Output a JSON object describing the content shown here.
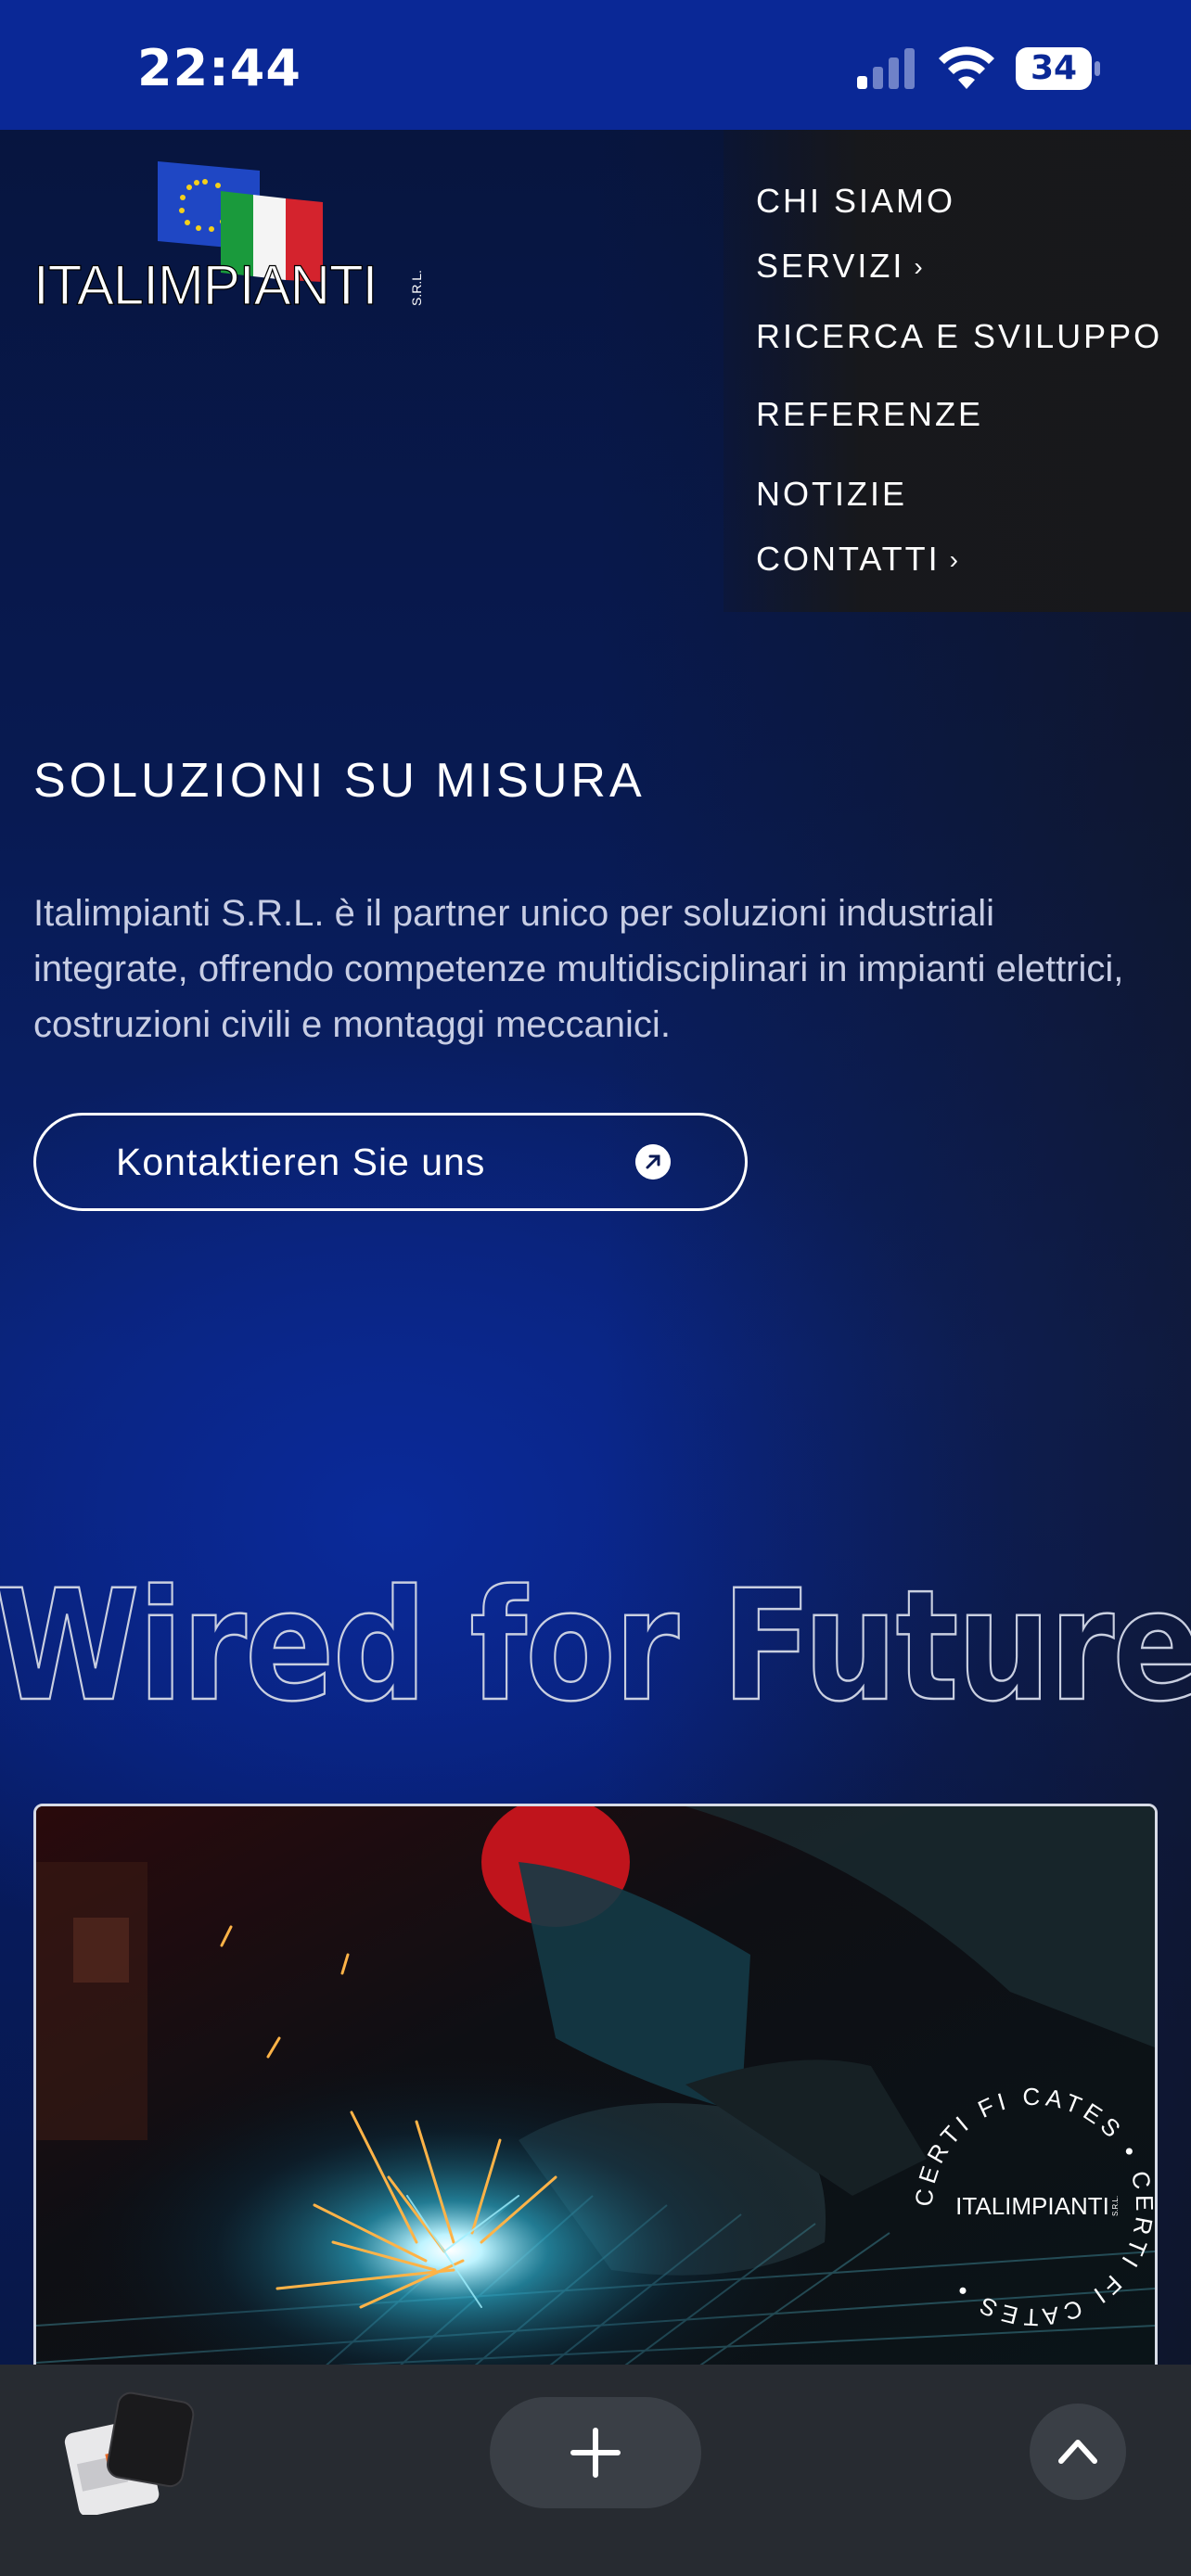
{
  "status": {
    "time": "22:44",
    "battery": "34",
    "signal_icon": "cellular-signal-icon",
    "wifi_icon": "wifi-icon",
    "battery_icon": "battery-icon"
  },
  "logo": {
    "brand": "ITALIMPIANTI",
    "suffix": "S.R.L."
  },
  "nav": {
    "items": [
      {
        "label": "CHI SIAMO",
        "has_submenu": false
      },
      {
        "label": "SERVIZI",
        "has_submenu": true
      },
      {
        "label": "RICERCA E SVILUPPO",
        "has_submenu": false
      },
      {
        "label": "REFERENZE",
        "has_submenu": false
      },
      {
        "label": "NOTIZIE",
        "has_submenu": false
      },
      {
        "label": "CONTATTI",
        "has_submenu": true
      }
    ],
    "chevron": "›"
  },
  "hero": {
    "title": "SOLUZIONI SU MISURA",
    "description": "Italimpianti S.R.L. è il partner unico per soluzioni industriali integrate, offrendo competenze multidisciplinari in impianti elettrici, costruzioni civili e montaggi meccanici.",
    "cta_label": "Kontaktieren Sie uns",
    "cta_icon": "arrow-up-right-icon",
    "outline_headline": "Wired for Future"
  },
  "badge": {
    "ring_text": "CERTI FI CATES • CERTI FI CATES •",
    "brand": "ITALIMPIANTI",
    "suffix": "S.R.L."
  },
  "colors": {
    "status_bar": "#0a2896",
    "hero_blue": "#0a2270",
    "menu_bg": "#18181a",
    "bottom_bar": "#272b31"
  },
  "toolbar": {
    "tabs_icon": "tab-switcher-icon",
    "add_icon": "plus-icon",
    "up_icon": "chevron-up-icon"
  }
}
